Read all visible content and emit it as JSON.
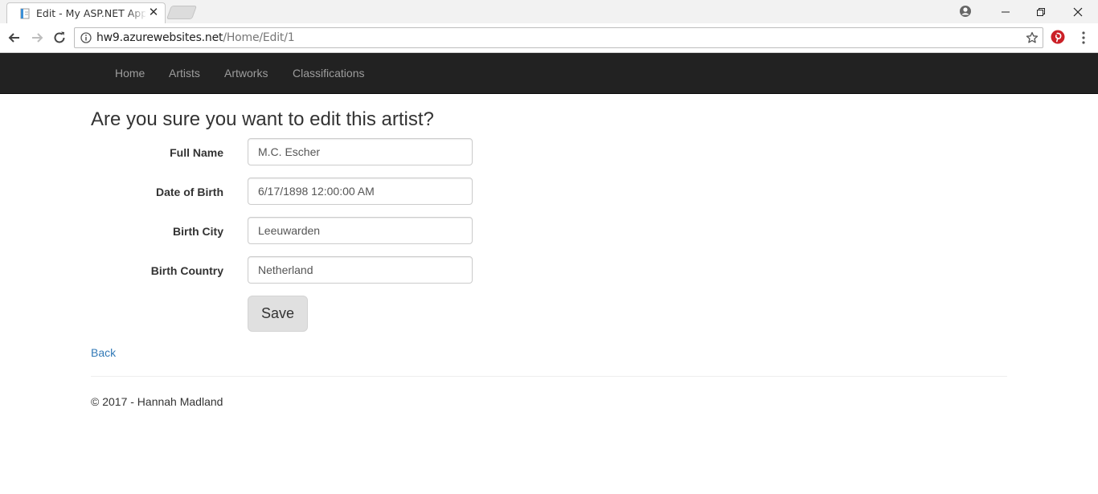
{
  "browser": {
    "tab_title": "Edit - My ASP.NET Application",
    "url_host": "hw9.azurewebsites.net",
    "url_path": "/Home/Edit/1",
    "icons": [
      "page-favicon-icon",
      "close-icon",
      "profile-icon",
      "minimize-icon",
      "maximize-icon",
      "window-close-icon",
      "back-arrow-icon",
      "forward-arrow-icon",
      "reload-icon",
      "info-icon",
      "bookmark-star-icon",
      "pinterest-icon",
      "kebab-menu-icon"
    ]
  },
  "navbar": {
    "links": [
      {
        "label": "Home"
      },
      {
        "label": "Artists"
      },
      {
        "label": "Artworks"
      },
      {
        "label": "Classifications"
      }
    ]
  },
  "page": {
    "heading": "Are you sure you want to edit this artist?",
    "fields": [
      {
        "label": "Full Name",
        "value": "M.C. Escher"
      },
      {
        "label": "Date of Birth",
        "value": "6/17/1898 12:00:00 AM"
      },
      {
        "label": "Birth City",
        "value": "Leeuwarden"
      },
      {
        "label": "Birth Country",
        "value": "Netherland"
      }
    ],
    "save_label": "Save",
    "back_label": "Back"
  },
  "footer": {
    "text": "© 2017 - Hannah Madland"
  },
  "colors": {
    "navbar_bg": "#222222",
    "nav_link": "#9d9d9d",
    "link": "#337ab7",
    "button_bg": "#e0e0e0"
  }
}
